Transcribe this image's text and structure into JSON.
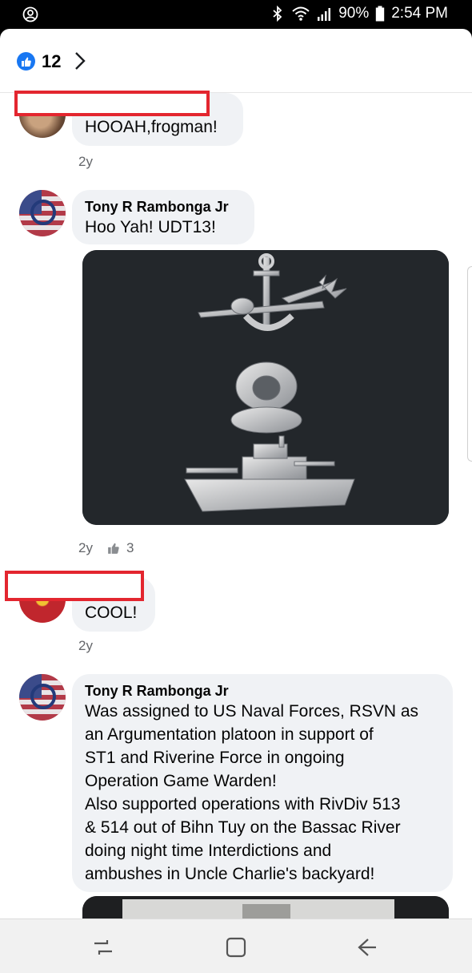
{
  "status_bar": {
    "battery": "90%",
    "time": "2:54 PM",
    "icons": [
      "account-circle-icon",
      "bluetooth-icon",
      "wifi-icon",
      "signal-icon",
      "battery-icon"
    ]
  },
  "reactions": {
    "icon": "thumbs-up-icon",
    "count": "12",
    "color": "#1877f2"
  },
  "comments": [
    {
      "author": "",
      "text": "HOOAH,frogman!",
      "time": "2y",
      "redacted_name": true
    },
    {
      "author": "Tony R Rambonga Jr",
      "text": "Hoo Yah! UDT13!",
      "time": "2y",
      "likes": "3",
      "has_photo": true
    },
    {
      "author": "",
      "text": "COOL!",
      "time": "2y",
      "redacted_name": true
    },
    {
      "author": "Tony R Rambonga Jr",
      "text": "Was assigned to US Naval Forces, RSVN as an Argumentation platoon in support of ST1 and Riverine Force in ongoing Operation Game Warden! Also supported operations with RivDiv 513 & 514 out of Bihn Tuy on the Bassac River doing night time Interdictions and ambushes in Uncle Charlie's backyard!"
    }
  ],
  "long_comment_lines": [
    "Was assigned to US Naval Forces, RSVN as",
    "an Argumentation platoon in support of",
    "ST1 and Riverine Force in ongoing",
    "Operation Game Warden!",
    "Also supported operations with RivDiv 513",
    "& 514 out of Bihn Tuy on the Bassac River",
    "doing night time Interdictions and",
    "ambushes in Uncle Charlie's backyard!"
  ],
  "nav": {
    "icons": [
      "recent-apps-icon",
      "home-icon",
      "back-icon"
    ]
  }
}
